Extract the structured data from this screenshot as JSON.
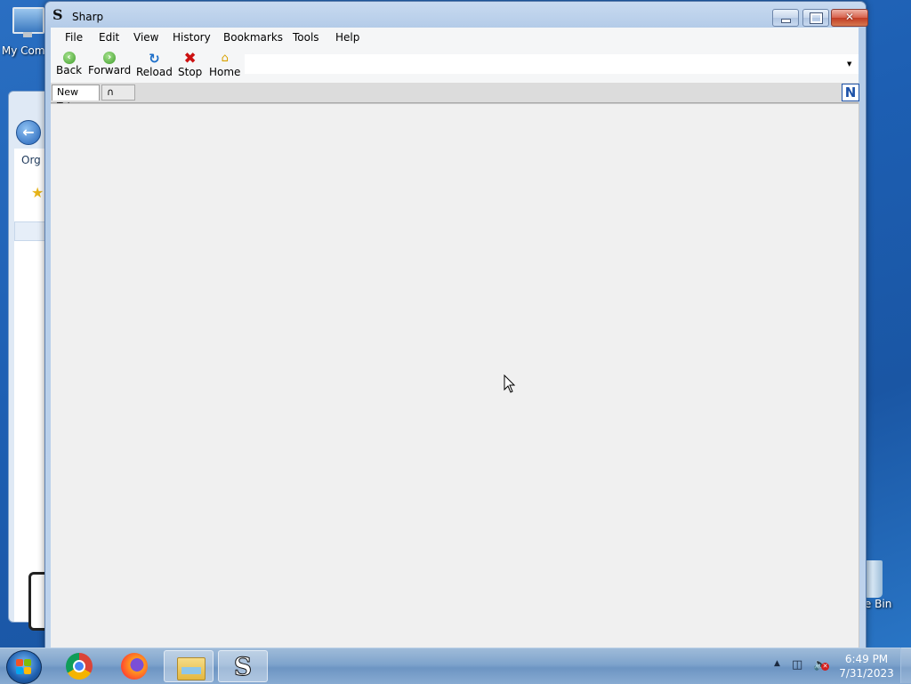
{
  "desktop": {
    "my_computer_label": "My Comp",
    "recycle_bin_label": "cle Bin"
  },
  "explorer_bg": {
    "organize_label": "Org"
  },
  "window": {
    "title": "Sharp",
    "logo_char": "S"
  },
  "menu": {
    "items": [
      "File",
      "Edit",
      "View",
      "History",
      "Bookmarks",
      "Tools",
      "Help"
    ]
  },
  "toolbar": {
    "back": "Back",
    "forward": "Forward",
    "reload": "Reload",
    "stop": "Stop",
    "home": "Home",
    "address_value": ""
  },
  "tabs": {
    "new_tab_label": "New Tab",
    "add_tab_label": "∩",
    "badge_letter": "N"
  },
  "taskbar": {
    "time": "6:49 PM",
    "date": "7/31/2023"
  },
  "colors": {
    "desktop_blue": "#1d5fb3",
    "window_frame": "#b3cbe8",
    "close_red": "#c23c24"
  },
  "icons": [
    "back-icon",
    "forward-icon",
    "reload-icon",
    "stop-icon",
    "home-icon",
    "chrome-icon",
    "firefox-icon",
    "file-explorer-icon",
    "sharp-icon",
    "network-icon",
    "volume-muted-icon",
    "windows-logo-icon"
  ]
}
